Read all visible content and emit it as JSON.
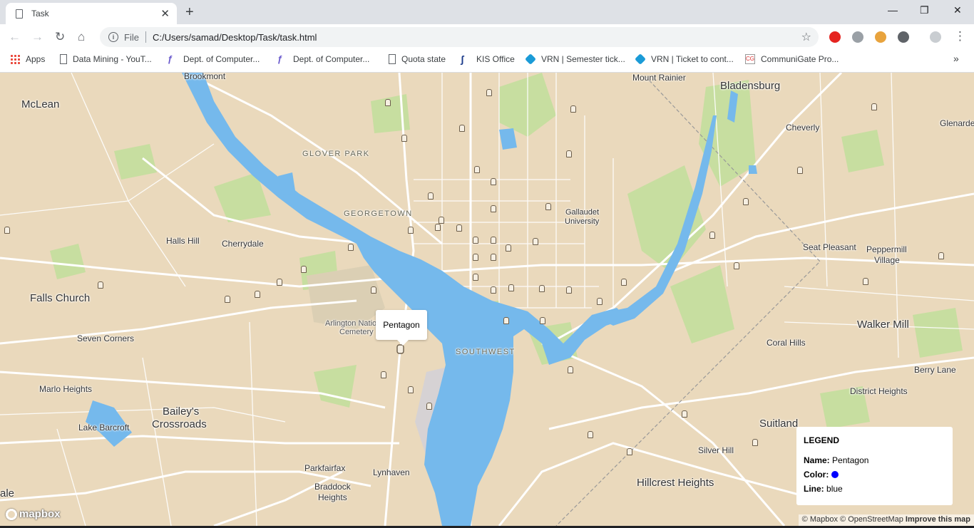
{
  "browser": {
    "tab_title": "Task",
    "new_tab": "+",
    "url_scheme": "File",
    "url": "C:/Users/samad/Desktop/Task/task.html",
    "bookmarks": [
      {
        "label": "Apps",
        "icon": "apps-grid-icon"
      },
      {
        "label": "Data Mining - YouT...",
        "icon": "page-icon"
      },
      {
        "label": "Dept. of Computer...",
        "icon": "university-icon"
      },
      {
        "label": "Dept. of Computer...",
        "icon": "university-icon"
      },
      {
        "label": "Quota state",
        "icon": "page-icon"
      },
      {
        "label": "KIS Office",
        "icon": "kis-icon"
      },
      {
        "label": "VRN | Semester tick...",
        "icon": "vrn-icon"
      },
      {
        "label": "VRN | Ticket to cont...",
        "icon": "vrn-icon"
      },
      {
        "label": "CommuniGate Pro...",
        "icon": "communigate-icon"
      }
    ],
    "more_bookmarks": "»"
  },
  "map": {
    "places": {
      "mclean": "McLean",
      "brookmont": "Brookmont",
      "mount_rainier": "Mount Rainier",
      "bladensburg": "Bladensburg",
      "glenarden": "Glenarde",
      "cheverly": "Cheverly",
      "glover_park": "GLOVER PARK",
      "georgetown": "GEORGETOWN",
      "gallaudet1": "Gallaudet",
      "gallaudet2": "University",
      "halls_hill": "Halls Hill",
      "cherrydale": "Cherrydale",
      "seat_pleasant": "Seat Pleasant",
      "peppermill1": "Peppermill",
      "peppermill2": "Village",
      "falls_church": "Falls Church",
      "arlington1": "Arlington Natio",
      "arlington2": "Cemetery",
      "seven_corners": "Seven Corners",
      "southwest": "SOUTHWEST",
      "walker_mill": "Walker Mill",
      "coral_hills": "Coral Hills",
      "berry_lane": "Berry Lane",
      "marlo_heights": "Marlo Heights",
      "district_heights": "District Heights",
      "baileys1": "Bailey's",
      "baileys2": "Crossroads",
      "lake_barcroft": "Lake Barcroft",
      "suitland": "Suitland",
      "silver_hill": "Silver Hill",
      "parkfairfax": "Parkfairfax",
      "lynhaven": "Lynhaven",
      "braddock1": "Braddock",
      "braddock2": "Heights",
      "hillcrest": "Hillcrest Heights",
      "dale": "ale"
    },
    "popup_label": "Pentagon",
    "attribution": {
      "mapbox": "© Mapbox",
      "osm": "© OpenStreetMap",
      "improve": "Improve this map"
    },
    "logo": "mapbox",
    "colors": {
      "land": "#ead9bc",
      "water": "#75b9ec",
      "park": "#c7dea0",
      "road": "#ffffff"
    }
  },
  "legend": {
    "title": "LEGEND",
    "name_label": "Name:",
    "name_value": "Pentagon",
    "color_label": "Color:",
    "color_value": "#0000ff",
    "line_label": "Line:",
    "line_value": "blue"
  }
}
